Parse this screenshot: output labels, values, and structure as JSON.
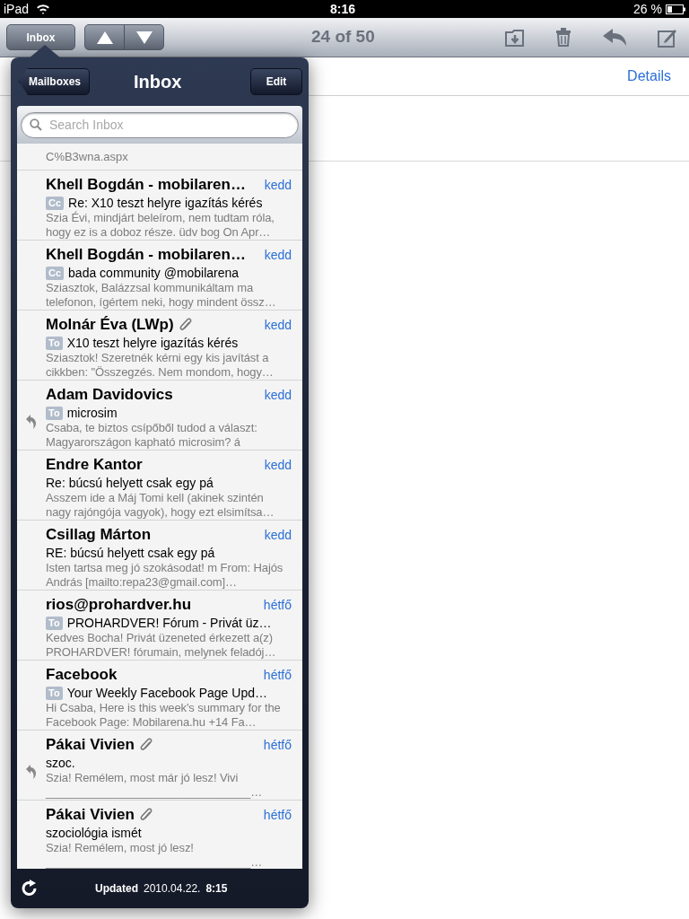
{
  "status_bar": {
    "device": "iPad",
    "time": "8:16",
    "battery": "26 %"
  },
  "toolbar": {
    "inbox_button": "Inbox",
    "counter": "24 of 50"
  },
  "message": {
    "details_link": "Details"
  },
  "popover": {
    "back_button": "Mailboxes",
    "title": "Inbox",
    "edit_button": "Edit",
    "search": {
      "placeholder": "Search Inbox"
    },
    "partial_row": {
      "preview": "C%B3wna.aspx"
    },
    "messages": [
      {
        "sender": "Khell Bogdán - mobilaren…",
        "date": "kedd",
        "badge": "Cc",
        "subject": "Re: X10 teszt helyre igazítás kérés",
        "preview": "Szia Évi, mindjárt beleírom, nem tudtam róla, hogy ez is a doboz része. üdv bog On Apr…",
        "attachment": false,
        "replied": false
      },
      {
        "sender": "Khell Bogdán - mobilaren…",
        "date": "kedd",
        "badge": "Cc",
        "subject": "bada community @mobilarena",
        "preview": "Sziasztok, Balázzsal kommunikáltam ma telefonon, ígértem neki, hogy mindent össz…",
        "attachment": false,
        "replied": false
      },
      {
        "sender": "Molnár Éva (LWp)",
        "date": "kedd",
        "badge": "To",
        "subject": "X10 teszt helyre igazítás kérés",
        "preview": "Sziasztok! Szeretnék kérni egy kis javítást a cikkben: \"Összegzés. Nem mondom, hogy…",
        "attachment": true,
        "replied": false
      },
      {
        "sender": "Adam Davidovics",
        "date": "kedd",
        "badge": "To",
        "subject": "microsim",
        "preview": "Csaba, te biztos csípőből tudod a választ: Magyarországon kapható microsim? á",
        "attachment": false,
        "replied": true
      },
      {
        "sender": "Endre Kantor",
        "date": "kedd",
        "subject": "Re: búcsú helyett csak egy pá",
        "preview": "Asszem ide a Máj Tomi kell (akinek szintén nagy rajóngója vagyok), hogy ezt elsimítsa…",
        "attachment": false,
        "replied": false
      },
      {
        "sender": "Csillag Márton",
        "date": "kedd",
        "subject": "RE: búcsú helyett csak egy pá",
        "preview": "Isten tartsa meg jó szokásodat! m From: Hajós András [mailto:repa23@gmail.com]…",
        "attachment": false,
        "replied": false
      },
      {
        "sender": "rios@prohardver.hu",
        "date": "hétfő",
        "badge": "To",
        "subject": "PROHARDVER! Fórum - Privát üz…",
        "preview": "Kedves Bocha! Privát üzeneted érkezett a(z) PROHARDVER! fórumain, melynek feladój…",
        "attachment": false,
        "replied": false
      },
      {
        "sender": "Facebook",
        "date": "hétfő",
        "badge": "To",
        "subject": "Your Weekly Facebook Page Upd…",
        "preview": "Hi Csaba, Here is this week's summary for the Facebook Page: Mobilarena.hu +14 Fa…",
        "attachment": false,
        "replied": false
      },
      {
        "sender": "Pákai Vivien",
        "date": "hétfő",
        "subject": "szoc.",
        "preview": "Szia! Remélem, most már jó lesz! Vivi ________________________________…",
        "attachment": true,
        "replied": true
      },
      {
        "sender": "Pákai Vivien",
        "date": "hétfő",
        "subject": "szociológia ismét",
        "preview": "Szia! Remélem, most jó lesz! ________________________________…",
        "attachment": true,
        "replied": false
      }
    ],
    "footer": {
      "label": "Updated",
      "date": "2010.04.22.",
      "time": "8:15"
    }
  }
}
